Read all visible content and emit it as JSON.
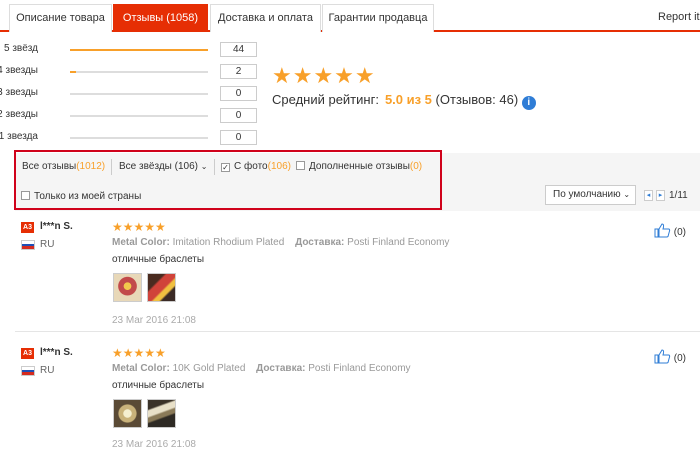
{
  "tabs": [
    {
      "label": "Описание товара",
      "active": false
    },
    {
      "label": "Отзывы (1058)",
      "active": true
    },
    {
      "label": "Доставка и оплата",
      "active": false
    },
    {
      "label": "Гарантии продавца",
      "active": false
    }
  ],
  "report_label": "Report iten",
  "rating_rows": [
    {
      "label": "5 звёзд",
      "count": "44",
      "fraction": 1.0
    },
    {
      "label": "4 звезды",
      "count": "2",
      "fraction": 0.045
    },
    {
      "label": "3 звезды",
      "count": "0",
      "fraction": 0
    },
    {
      "label": "2 звезды",
      "count": "0",
      "fraction": 0
    },
    {
      "label": "1 звезда",
      "count": "0",
      "fraction": 0
    }
  ],
  "summary": {
    "stars": "★★★★★",
    "avg_label": "Средний рейтинг:",
    "avg_value": "5.0 из 5",
    "reviews_count": "(Отзывов: 46)",
    "info_icon": "i"
  },
  "filters": {
    "all_reviews_label": "Все отзывы",
    "all_reviews_count": "(1012)",
    "all_stars": "Все звёзды (106)",
    "with_photo_label": "С фото",
    "with_photo_count": "(106)",
    "with_photo_checked": true,
    "supplemented_label": "Дополненные отзывы",
    "supplemented_count": "(0)",
    "my_country_label": "Только из моей страны",
    "sort_label": "По умолчанию",
    "page_prev": "◂",
    "page_next": "▸",
    "page_info": "1/11"
  },
  "colors": {
    "accent": "#e62e04",
    "star": "#f8a02a",
    "highlight": "#d0021b",
    "link": "#2f7dd6"
  },
  "reviews": [
    {
      "badge": "A3",
      "user": "l***n S.",
      "country": "RU",
      "stars": "★★★★★",
      "metal_label": "Metal Color:",
      "metal_value": "Imitation Rhodium Plated",
      "ship_label": "Доставка:",
      "ship_value": "Posti Finland Economy",
      "text": "отличные браслеты",
      "date": "23 Mar 2016 21:08",
      "likes": "(0)"
    },
    {
      "badge": "A3",
      "user": "l***n S.",
      "country": "RU",
      "stars": "★★★★★",
      "metal_label": "Metal Color:",
      "metal_value": "10K Gold Plated",
      "ship_label": "Доставка:",
      "ship_value": "Posti Finland Economy",
      "text": "отличные браслеты",
      "date": "23 Mar 2016 21:08",
      "likes": "(0)"
    }
  ]
}
